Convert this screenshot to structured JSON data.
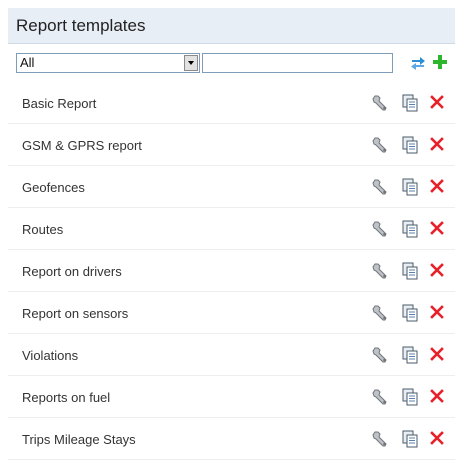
{
  "header": {
    "title": "Report templates"
  },
  "filter": {
    "selected": "All",
    "search_value": ""
  },
  "icons": {
    "swap": "swap-arrows-icon",
    "add": "plus-icon",
    "wrench": "wrench-icon",
    "copy": "copy-icon",
    "delete": "close-icon"
  },
  "colors": {
    "header_bg": "#e8eef6",
    "add_green": "#2db52d",
    "delete_red": "#e8202a",
    "swap_blue": "#2c8fd6"
  },
  "templates": [
    {
      "name": "Basic Report"
    },
    {
      "name": "GSM & GPRS report"
    },
    {
      "name": "Geofences"
    },
    {
      "name": "Routes"
    },
    {
      "name": "Report on drivers"
    },
    {
      "name": "Report on sensors"
    },
    {
      "name": "Violations"
    },
    {
      "name": "Reports on fuel"
    },
    {
      "name": "Trips Mileage Stays"
    }
  ]
}
